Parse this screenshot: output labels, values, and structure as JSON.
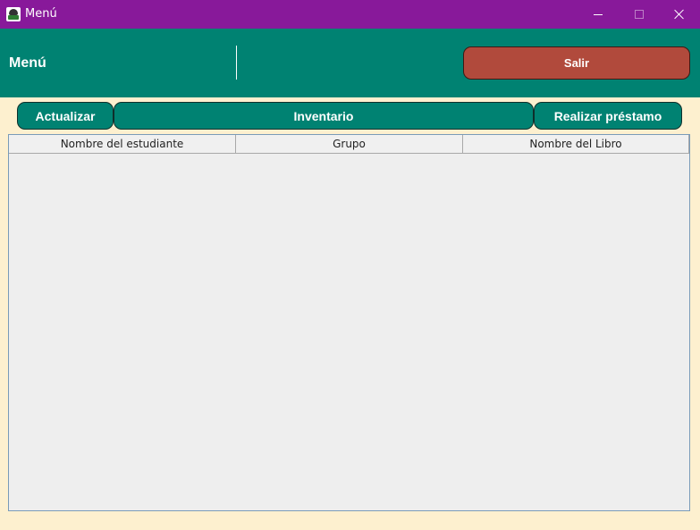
{
  "window": {
    "title": "Menú",
    "icon": "app-icon",
    "controls": [
      "minimize-icon",
      "maximize-icon",
      "close-icon"
    ]
  },
  "header": {
    "title": "Menú",
    "exit_label": "Salir"
  },
  "actions": {
    "update_label": "Actualizar",
    "inventory_label": "Inventario",
    "loan_label": "Realizar préstamo"
  },
  "table": {
    "columns": [
      "Nombre del estudiante",
      "Grupo",
      "Nombre del Libro"
    ],
    "rows": []
  },
  "colors": {
    "title_bar": "#88199a",
    "header": "#008272",
    "exit_button": "#b14a3c",
    "background": "#fdf0cf"
  }
}
